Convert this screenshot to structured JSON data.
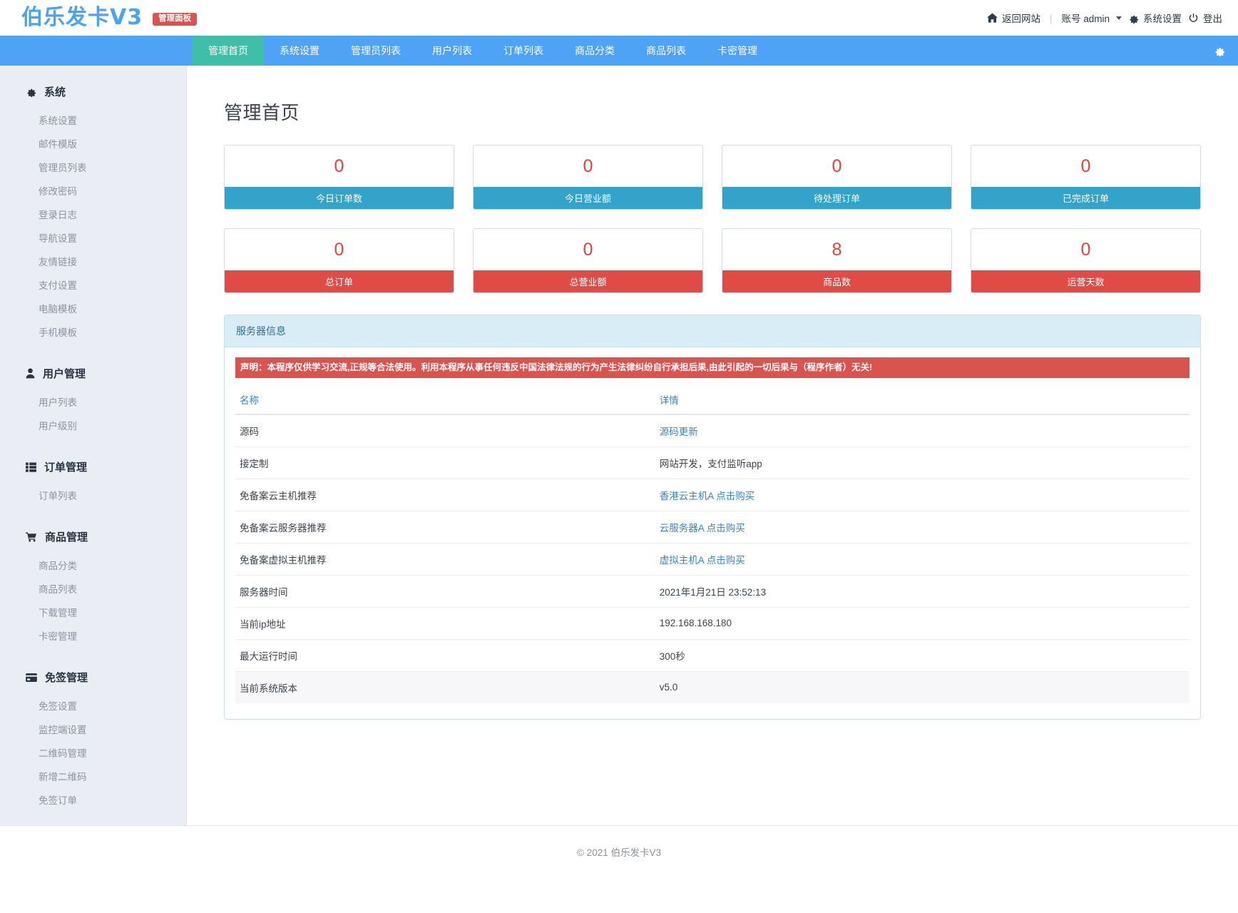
{
  "header": {
    "logo_text": "伯乐发卡V3",
    "badge": "管理面板",
    "back_site": "返回网站",
    "separator": "|",
    "account": "账号 admin",
    "settings": "系统设置",
    "logout": "登出"
  },
  "nav": {
    "items": [
      {
        "label": "管理首页",
        "active": true
      },
      {
        "label": "系统设置",
        "active": false
      },
      {
        "label": "管理员列表",
        "active": false
      },
      {
        "label": "用户列表",
        "active": false
      },
      {
        "label": "订单列表",
        "active": false
      },
      {
        "label": "商品分类",
        "active": false
      },
      {
        "label": "商品列表",
        "active": false
      },
      {
        "label": "卡密管理",
        "active": false
      }
    ]
  },
  "sidebar": {
    "groups": [
      {
        "title": "系统",
        "icon": "gear-icon",
        "items": [
          "系统设置",
          "邮件模版",
          "管理员列表",
          "修改密码",
          "登录日志",
          "导航设置",
          "友情链接",
          "支付设置",
          "电脑模板",
          "手机模板"
        ]
      },
      {
        "title": "用户管理",
        "icon": "user-icon",
        "items": [
          "用户列表",
          "用户级别"
        ]
      },
      {
        "title": "订单管理",
        "icon": "list-icon",
        "items": [
          "订单列表"
        ]
      },
      {
        "title": "商品管理",
        "icon": "cart-icon",
        "items": [
          "商品分类",
          "商品列表",
          "下载管理",
          "卡密管理"
        ]
      },
      {
        "title": "免签管理",
        "icon": "card-icon",
        "items": [
          "免签设置",
          "监控端设置",
          "二维码管理",
          "新增二维码",
          "免签订单"
        ]
      }
    ]
  },
  "main": {
    "page_title": "管理首页",
    "stat_rows": [
      {
        "style": "blue",
        "cards": [
          {
            "value": "0",
            "label": "今日订单数"
          },
          {
            "value": "0",
            "label": "今日营业额"
          },
          {
            "value": "0",
            "label": "待处理订单"
          },
          {
            "value": "0",
            "label": "已完成订单"
          }
        ]
      },
      {
        "style": "red",
        "cards": [
          {
            "value": "0",
            "label": "总订单"
          },
          {
            "value": "0",
            "label": "总营业额"
          },
          {
            "value": "8",
            "label": "商品数"
          },
          {
            "value": "0",
            "label": "运营天数"
          }
        ]
      }
    ],
    "panel": {
      "title": "服务器信息",
      "alert": "声明：本程序仅供学习交流,正规等合法使用。利用本程序从事任何违反中国法律法规的行为产生法律纠纷自行承担后果,由此引起的一切后果与（程序作者）无关!",
      "columns": [
        "名称",
        "详情"
      ],
      "rows": [
        {
          "name": "源码",
          "detail": "源码更新",
          "is_link": true
        },
        {
          "name": "接定制",
          "detail": "网站开发，支付监听app",
          "is_link": false
        },
        {
          "name": "免备案云主机推荐",
          "detail": "香港云主机A 点击购买",
          "is_link": true
        },
        {
          "name": "免备案云服务器推荐",
          "detail": "云服务器A 点击购买",
          "is_link": true
        },
        {
          "name": "免备案虚拟主机推荐",
          "detail": "虚拟主机A 点击购买",
          "is_link": true
        },
        {
          "name": "服务器时间",
          "detail": "2021年1月21日 23:52:13",
          "is_link": false
        },
        {
          "name": "当前ip地址",
          "detail": "192.168.168.180",
          "is_link": false
        },
        {
          "name": "最大运行时间",
          "detail": "300秒",
          "is_link": false
        },
        {
          "name": "当前系统版本",
          "detail": "v5.0",
          "is_link": false
        }
      ]
    }
  },
  "footer": {
    "text": "©  2021 伯乐发卡V3"
  },
  "colors": {
    "nav_blue": "#4fa3f7",
    "nav_active": "#3fbfa8",
    "stat_blue": "#33a3c9",
    "stat_red": "#e04b45",
    "value_red": "#e8413a",
    "badge_red": "#d9534f",
    "panel_head": "#d9edf7",
    "link": "#3a84c9",
    "sidebar_bg": "#eaedf4"
  }
}
